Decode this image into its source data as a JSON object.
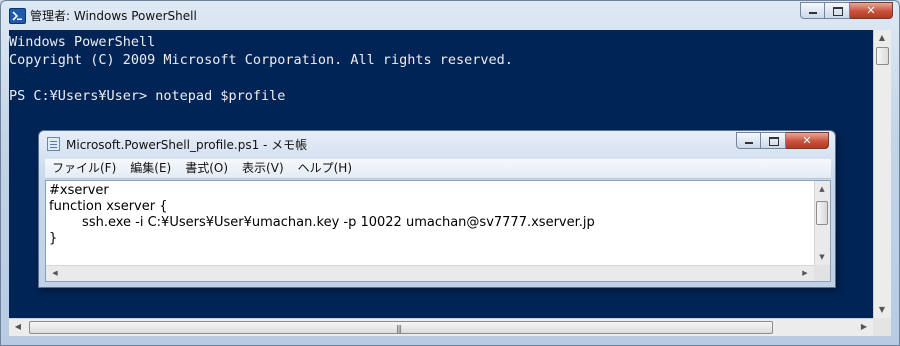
{
  "powershell": {
    "title": "管理者: Windows PowerShell",
    "console_lines": [
      "Windows PowerShell",
      "Copyright (C) 2009 Microsoft Corporation. All rights reserved.",
      "",
      "PS C:¥Users¥User> notepad $profile"
    ],
    "close_glyph": "✕",
    "scroll_up": "▲",
    "scroll_down": "▼",
    "scroll_left": "◀",
    "scroll_right": "▶",
    "grip": "|||"
  },
  "notepad": {
    "title": "Microsoft.PowerShell_profile.ps1 - メモ帳",
    "menu": [
      "ファイル(F)",
      "編集(E)",
      "書式(O)",
      "表示(V)",
      "ヘルプ(H)"
    ],
    "lines": [
      "#xserver",
      "function xserver {",
      "        ssh.exe -i C:¥Users¥User¥umachan.key -p 10022 umachan@sv7777.xserver.jp",
      "}"
    ],
    "close_glyph": "✕",
    "scroll_up": "▲",
    "scroll_down": "▼",
    "scroll_left": "◀",
    "scroll_right": "▶"
  },
  "icons": {
    "powershell": "powershell-icon",
    "notepad": "notepad-icon"
  },
  "colors": {
    "console_background": "#012456",
    "console_text": "#eeedf0",
    "close_button": "#c8523b"
  }
}
